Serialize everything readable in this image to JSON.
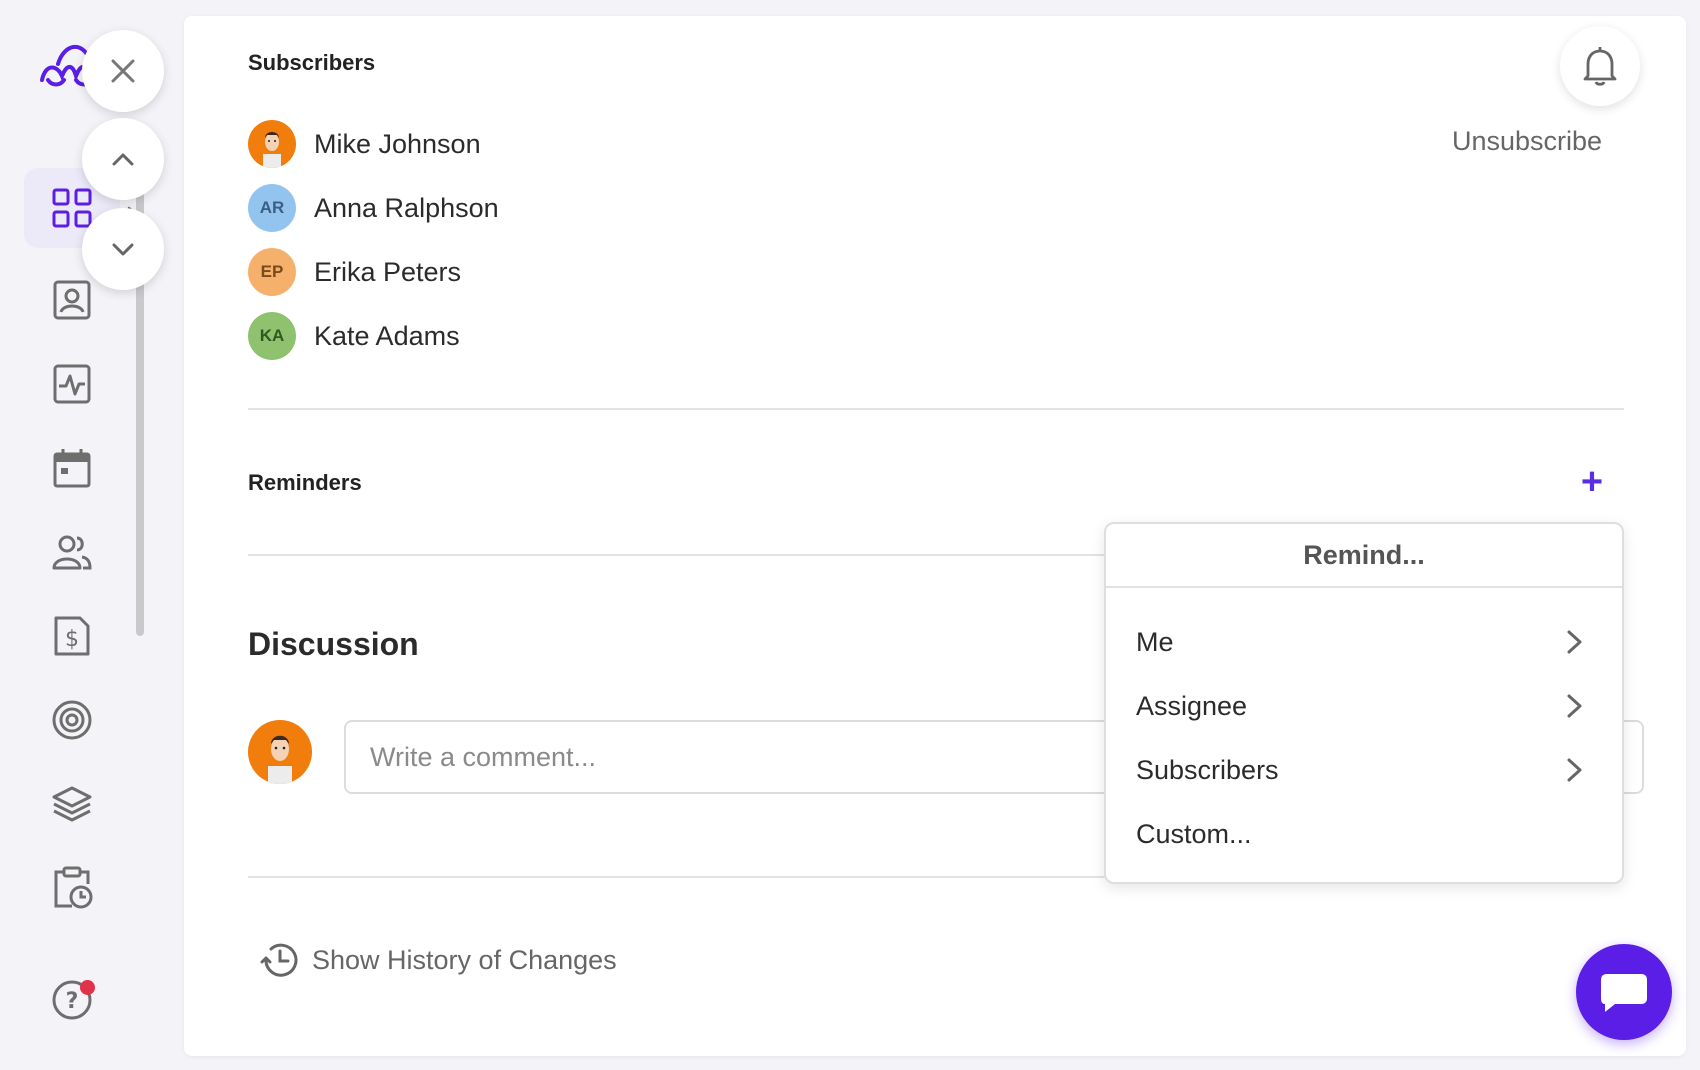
{
  "app": {
    "brand_color": "#5b1ee6",
    "accent_color": "#5b2ee0"
  },
  "sidebar": {
    "items": [
      {
        "icon": "dashboard-grid-icon",
        "active": true
      },
      {
        "icon": "contact-card-icon"
      },
      {
        "icon": "activity-pulse-icon"
      },
      {
        "icon": "calendar-icon"
      },
      {
        "icon": "users-icon"
      },
      {
        "icon": "invoice-dollar-icon"
      },
      {
        "icon": "target-icon"
      },
      {
        "icon": "layers-icon"
      },
      {
        "icon": "clipboard-clock-icon"
      },
      {
        "icon": "help-icon",
        "notification": true
      }
    ]
  },
  "subscribers": {
    "title": "Subscribers",
    "unsubscribe_label": "Unsubscribe",
    "list": [
      {
        "name": "Mike Johnson",
        "initials": "",
        "avatar_color": "#f07d0c",
        "photo": true
      },
      {
        "name": "Anna Ralphson",
        "initials": "AR",
        "avatar_color": "#93c4ef",
        "initials_color": "#3c5e80"
      },
      {
        "name": "Erika Peters",
        "initials": "EP",
        "avatar_color": "#f5b06c",
        "initials_color": "#7a4a1a"
      },
      {
        "name": "Kate Adams",
        "initials": "KA",
        "avatar_color": "#8ec26f",
        "initials_color": "#2f5a1d"
      }
    ]
  },
  "reminders": {
    "title": "Reminders",
    "add_label": "+",
    "dropdown": {
      "header": "Remind...",
      "items": [
        {
          "label": "Me",
          "has_submenu": true
        },
        {
          "label": "Assignee",
          "has_submenu": true
        },
        {
          "label": "Subscribers",
          "has_submenu": true
        },
        {
          "label": "Custom...",
          "has_submenu": false
        }
      ]
    }
  },
  "discussion": {
    "title": "Discussion",
    "comment_placeholder": "Write a comment..."
  },
  "history": {
    "label": "Show History of Changes"
  }
}
